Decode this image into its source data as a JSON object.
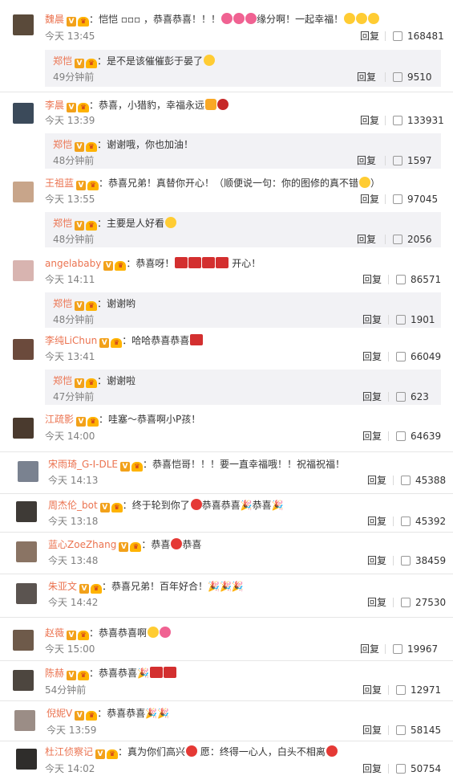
{
  "comments": [
    {
      "name": "魏晨",
      "text": "恺恺 ▫▫▫ ，恭喜恭喜！！！",
      "text2": "缘分啊！一起幸福！",
      "time": "今天 13:45",
      "reply": "回复",
      "likes": "168481",
      "sub": {
        "name": "郑恺",
        "text": "是不是该催催彭于晏了",
        "time": "49分钟前",
        "reply": "回复",
        "likes": "9510"
      }
    },
    {
      "name": "李晨",
      "text": "恭喜，小猎豹，幸福永远",
      "time": "今天 13:39",
      "reply": "回复",
      "likes": "133931",
      "sub": {
        "name": "郑恺",
        "text": "谢谢哦，你也加油！",
        "time": "48分钟前",
        "reply": "回复",
        "likes": "1597"
      }
    },
    {
      "name": "王祖蓝",
      "text": "恭喜兄弟！真替你开心！（顺便说一句：你的图修的真不错",
      "text2": "）",
      "time": "今天 13:55",
      "reply": "回复",
      "likes": "97045",
      "sub": {
        "name": "郑恺",
        "text": "主要是人好看",
        "time": "48分钟前",
        "reply": "回复",
        "likes": "2056"
      }
    },
    {
      "name": "angelababy",
      "text": "恭喜呀！",
      "text2": "开心！",
      "time": "今天 14:11",
      "reply": "回复",
      "likes": "86571",
      "sub": {
        "name": "郑恺",
        "text": "谢谢哟",
        "time": "48分钟前",
        "reply": "回复",
        "likes": "1901"
      }
    },
    {
      "name": "李纯LiChun",
      "text": "哈哈恭喜恭喜",
      "time": "今天 13:41",
      "reply": "回复",
      "likes": "66049",
      "sub": {
        "name": "郑恺",
        "text": "谢谢啦",
        "time": "47分钟前",
        "reply": "回复",
        "likes": "623"
      }
    },
    {
      "name": "江疏影",
      "text": "哇塞～恭喜啊小P孩！",
      "time": "今天 14:00",
      "reply": "回复",
      "likes": "64639"
    },
    {
      "name": "宋雨琦_G-I-DLE",
      "text": "恭喜恺哥！！！要一直幸福哦！！祝福祝福！",
      "time": "今天 14:13",
      "reply": "回复",
      "likes": "45388"
    },
    {
      "name": "周杰伦_bot",
      "text": "终于轮到你了",
      "text2": "恭喜恭喜🎉恭喜🎉",
      "time": "今天 13:18",
      "reply": "回复",
      "likes": "45392"
    },
    {
      "name": "蓝心ZoeZhang",
      "text": "恭喜",
      "text2": "恭喜",
      "time": "今天 13:48",
      "reply": "回复",
      "likes": "38459"
    },
    {
      "name": "朱亚文",
      "text": "恭喜兄弟！百年好合！🎉🎉🎉",
      "time": "今天 14:42",
      "reply": "回复",
      "likes": "27530"
    },
    {
      "name": "赵薇",
      "text": "恭喜恭喜啊",
      "time": "今天 15:00",
      "reply": "回复",
      "likes": "19967"
    },
    {
      "name": "陈赫",
      "text": "恭喜恭喜🎉",
      "time": "54分钟前",
      "reply": "回复",
      "likes": "12971"
    },
    {
      "name": "倪妮V",
      "text": "恭喜恭喜🎉🎉",
      "time": "今天 13:59",
      "reply": "回复",
      "likes": "58145"
    },
    {
      "name": "杜江侦察记",
      "text": "真为你们高兴",
      "text2": "愿：终得一心人，白头不相离",
      "time": "今天 14:02",
      "reply": "回复",
      "likes": "50754"
    }
  ],
  "colors": {
    "username": "#eb7350",
    "badge": "#f2a11a",
    "reply_bg": "#f2f2f5"
  }
}
